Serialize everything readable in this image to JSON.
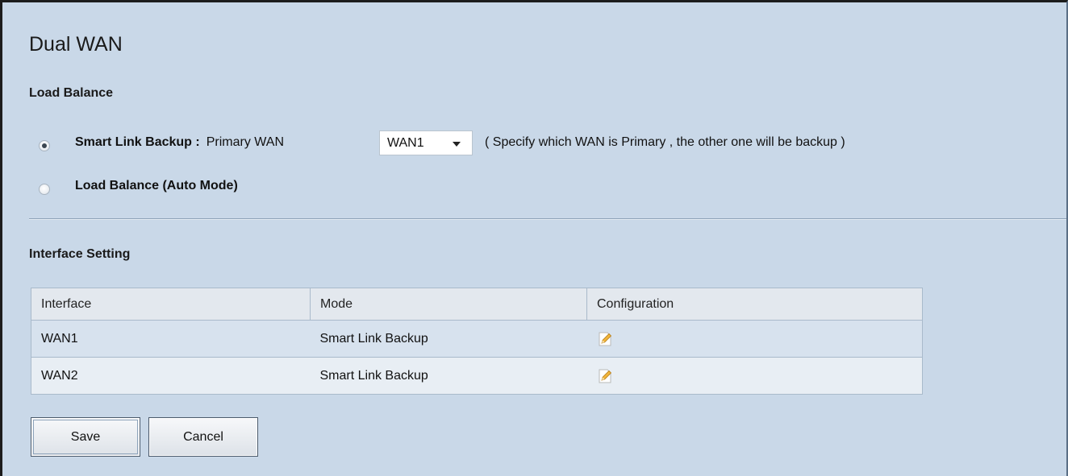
{
  "page": {
    "title": "Dual WAN"
  },
  "load_balance": {
    "heading": "Load Balance",
    "smart_link_backup": {
      "label": "Smart Link Backup :",
      "selected": true,
      "primary_wan_label": "Primary WAN",
      "primary_wan_value": "WAN1",
      "hint": "( Specify which WAN is Primary , the other one will be backup )"
    },
    "auto_mode": {
      "label": "Load Balance (Auto Mode)",
      "selected": false
    }
  },
  "interface_setting": {
    "heading": "Interface Setting",
    "columns": [
      "Interface",
      "Mode",
      "Configuration"
    ],
    "rows": [
      {
        "interface": "WAN1",
        "mode": "Smart Link Backup",
        "config_icon": "edit-icon"
      },
      {
        "interface": "WAN2",
        "mode": "Smart Link Backup",
        "config_icon": "edit-icon"
      }
    ]
  },
  "buttons": {
    "save_label": "Save",
    "cancel_label": "Cancel"
  },
  "colors": {
    "background": "#c9d8e8",
    "row_odd": "#d7e2ee",
    "row_even": "#e8eef4",
    "header": "#e3e8ee"
  }
}
